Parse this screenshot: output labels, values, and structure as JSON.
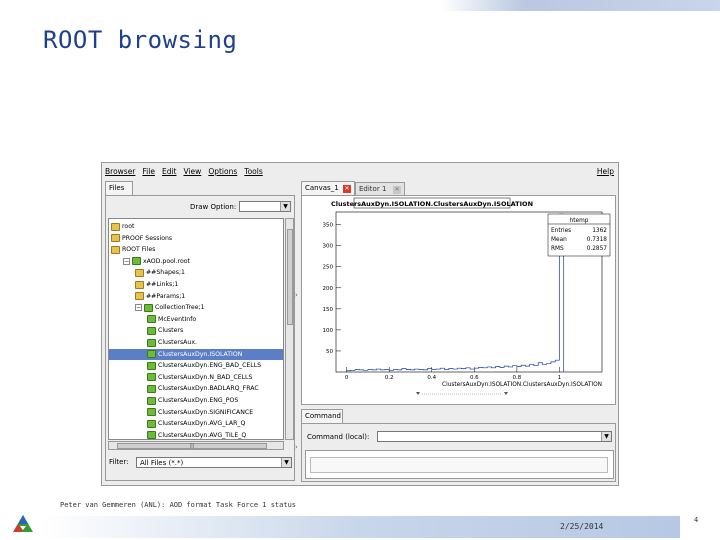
{
  "slide": {
    "title": "ROOT browsing",
    "footer_author": "Peter van Gemmeren (ANL): AOD format Task Force 1 status",
    "footer_date": "2/25/2014",
    "page_number": "4"
  },
  "app": {
    "menu": [
      "Browser",
      "File",
      "Edit",
      "View",
      "Options",
      "Tools"
    ],
    "help": "Help",
    "files_tab": "Files",
    "draw_option_label": "Draw Option:",
    "filter_label": "Filter:",
    "filter_value": "All Files (*.*)",
    "canvas_tab": "Canvas_1",
    "editor_tab": "Editor 1",
    "command_tab": "Command",
    "command_label": "Command (local):",
    "tree": [
      {
        "label": "root",
        "icon": "folder-icon",
        "indent": 0
      },
      {
        "label": "PROOF Sessions",
        "icon": "folder-icon",
        "indent": 0
      },
      {
        "label": "ROOT Files",
        "icon": "folder-icon",
        "indent": 0
      },
      {
        "label": "xAOD.pool.root",
        "icon": "root-file-icon",
        "indent": 1,
        "expander": "−"
      },
      {
        "label": "##Shapes;1",
        "icon": "folder-icon",
        "indent": 2
      },
      {
        "label": "##Links;1",
        "icon": "folder-icon",
        "indent": 2
      },
      {
        "label": "##Params;1",
        "icon": "folder-icon",
        "indent": 2
      },
      {
        "label": "CollectionTree;1",
        "icon": "tree-icon",
        "indent": 2,
        "expander": "−"
      },
      {
        "label": "McEventInfo",
        "icon": "branch-icon",
        "indent": 3
      },
      {
        "label": "Clusters",
        "icon": "branch-icon",
        "indent": 3
      },
      {
        "label": "ClustersAux.",
        "icon": "branch-icon",
        "indent": 3
      },
      {
        "label": "ClustersAuxDyn.ISOLATION",
        "icon": "leaf-icon",
        "indent": 3,
        "selected": true
      },
      {
        "label": "ClustersAuxDyn.ENG_BAD_CELLS",
        "icon": "leaf-icon",
        "indent": 3
      },
      {
        "label": "ClustersAuxDyn.N_BAD_CELLS",
        "icon": "leaf-icon",
        "indent": 3
      },
      {
        "label": "ClustersAuxDyn.BADLARQ_FRAC",
        "icon": "leaf-icon",
        "indent": 3
      },
      {
        "label": "ClustersAuxDyn.ENG_POS",
        "icon": "leaf-icon",
        "indent": 3
      },
      {
        "label": "ClustersAuxDyn.SIGNIFICANCE",
        "icon": "leaf-icon",
        "indent": 3
      },
      {
        "label": "ClustersAuxDyn.AVG_LAR_Q",
        "icon": "leaf-icon",
        "indent": 3
      },
      {
        "label": "ClustersAuxDyn.AVG_TILE_Q",
        "icon": "leaf-icon",
        "indent": 3
      }
    ]
  },
  "chart_data": {
    "type": "bar",
    "title": "ClustersAuxDyn.ISOLATION.ClustersAuxDyn.ISOLATION",
    "xlabel": "ClustersAuxDyn.ISOLATION.ClustersAuxDyn.ISOLATION",
    "xlim": [
      -0.05,
      1.2
    ],
    "ylim": [
      0,
      380
    ],
    "x_ticks": [
      0,
      0.2,
      0.4,
      0.6,
      0.8,
      1
    ],
    "y_ticks": [
      50,
      100,
      150,
      200,
      250,
      300,
      350
    ],
    "stats": {
      "name": "htemp",
      "rows": [
        [
          "Entries",
          "1362"
        ],
        [
          "Mean",
          "0.7318"
        ],
        [
          "RMS",
          "0.2857"
        ]
      ]
    },
    "bins": {
      "x": [
        0.0,
        0.02,
        0.04,
        0.06,
        0.08,
        0.1,
        0.12,
        0.14,
        0.16,
        0.18,
        0.2,
        0.22,
        0.24,
        0.26,
        0.28,
        0.3,
        0.32,
        0.34,
        0.36,
        0.38,
        0.4,
        0.42,
        0.44,
        0.46,
        0.48,
        0.5,
        0.52,
        0.54,
        0.56,
        0.58,
        0.6,
        0.62,
        0.64,
        0.66,
        0.68,
        0.7,
        0.72,
        0.74,
        0.76,
        0.78,
        0.8,
        0.82,
        0.84,
        0.86,
        0.88,
        0.9,
        0.92,
        0.94,
        0.96,
        0.98,
        1.0
      ],
      "values": [
        3,
        4,
        6,
        5,
        4,
        6,
        5,
        7,
        5,
        6,
        4,
        6,
        5,
        8,
        6,
        5,
        7,
        6,
        5,
        8,
        6,
        7,
        9,
        6,
        8,
        7,
        9,
        8,
        10,
        7,
        9,
        11,
        10,
        12,
        10,
        13,
        11,
        14,
        12,
        15,
        13,
        16,
        14,
        18,
        15,
        22,
        18,
        20,
        24,
        28,
        375
      ]
    }
  }
}
